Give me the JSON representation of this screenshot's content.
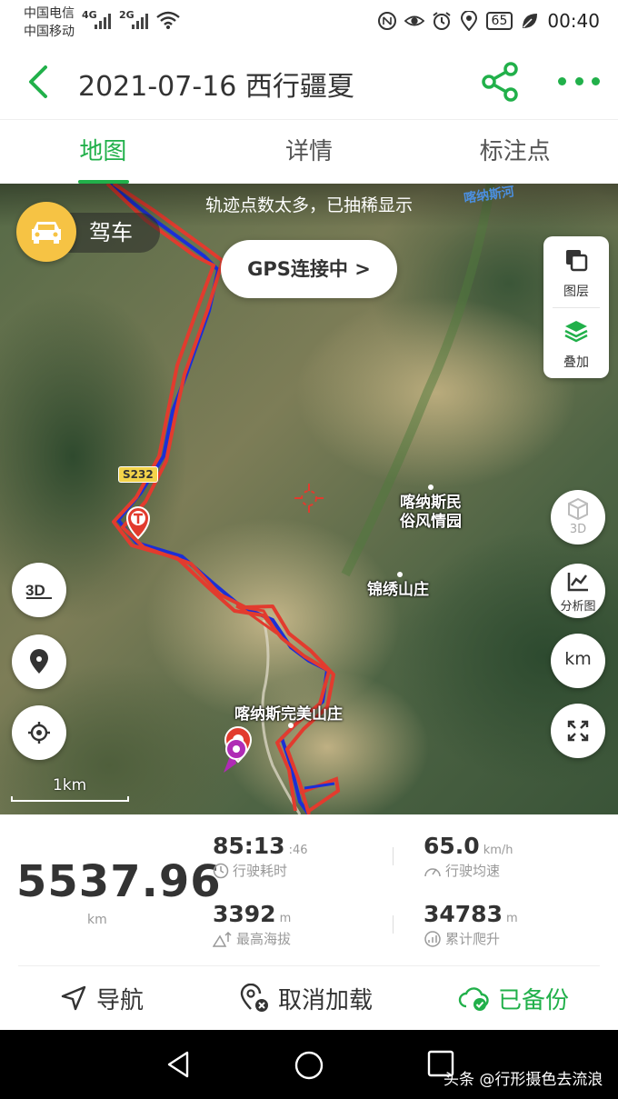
{
  "status_bar": {
    "carrier1": "中国电信",
    "carrier2": "中国移动",
    "net1": "4G",
    "net2": "2G",
    "battery": "65",
    "time": "00:40",
    "icons": [
      "nfc-icon",
      "eye-icon",
      "alarm-icon",
      "location-icon",
      "leaf-icon"
    ]
  },
  "header": {
    "title": "2021-07-16 西行疆夏",
    "back_icon": "chevron-left-icon",
    "share_icon": "share-icon",
    "more_icon": "more-dots-icon"
  },
  "tabs": [
    {
      "label": "地图",
      "active": true
    },
    {
      "label": "详情",
      "active": false
    },
    {
      "label": "标注点",
      "active": false
    }
  ],
  "map": {
    "banner": "轨迹点数太多，已抽稀显示",
    "river_label": "喀纳斯河",
    "mode_label": "驾车",
    "gps_button": "GPS连接中 >",
    "layers": [
      {
        "label": "图层",
        "icon": "layers-square-icon"
      },
      {
        "label": "叠加",
        "icon": "stack-icon"
      }
    ],
    "right_controls": [
      {
        "label": "3D",
        "icon": "cube-icon"
      },
      {
        "label": "分析图",
        "icon": "chart-icon"
      },
      {
        "label": "km",
        "icon": ""
      },
      {
        "label": "",
        "icon": "fullscreen-icon"
      }
    ],
    "left_controls": [
      {
        "label": "3D",
        "icon": "3d-icon"
      },
      {
        "label": "",
        "icon": "footprint-pin-icon"
      },
      {
        "label": "",
        "icon": "locate-icon"
      }
    ],
    "road_sign": "S232",
    "places": [
      "喀纳斯民",
      "俗风情园",
      "锦绣山庄",
      "喀纳斯完美山庄"
    ],
    "scale": "1km",
    "colors": {
      "track_red": "#e23b2e",
      "track_blue": "#1b2fd6",
      "accent": "#21b04a"
    }
  },
  "stats": {
    "distance": {
      "value": "5537.96",
      "unit": "km"
    },
    "duration": {
      "value": "85:13",
      "suffix": ":46",
      "label": "行驶耗时"
    },
    "avg_speed": {
      "value": "65.0",
      "unit": "km/h",
      "label": "行驶均速"
    },
    "max_alt": {
      "value": "3392",
      "unit": "m",
      "label": "最高海拔"
    },
    "climb": {
      "value": "34783",
      "unit": "m",
      "label": "累计爬升"
    }
  },
  "actions": [
    {
      "label": "导航",
      "icon": "navigate-arrow-icon"
    },
    {
      "label": "取消加载",
      "icon": "pin-cancel-icon"
    },
    {
      "label": "已备份",
      "icon": "cloud-check-icon"
    }
  ],
  "nav_bar": {
    "watermark": "头条 @行形摄色去流浪"
  }
}
